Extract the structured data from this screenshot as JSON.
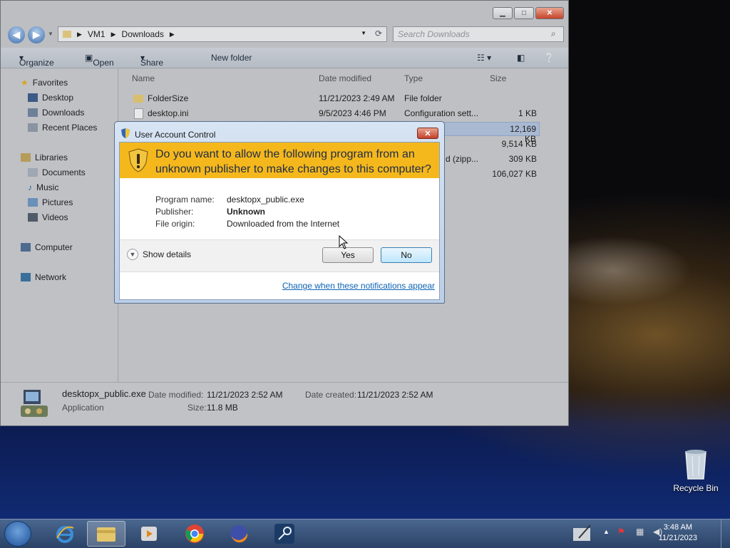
{
  "explorer": {
    "breadcrumb": [
      "VM1",
      "Downloads"
    ],
    "search_placeholder": "Search Downloads",
    "toolbar": {
      "organize": "Organize",
      "open": "Open",
      "share_with": "Share with",
      "new_folder": "New folder"
    },
    "nav": {
      "favorites": "Favorites",
      "desktop": "Desktop",
      "downloads": "Downloads",
      "recent": "Recent Places",
      "libraries": "Libraries",
      "documents": "Documents",
      "music": "Music",
      "pictures": "Pictures",
      "videos": "Videos",
      "computer": "Computer",
      "network": "Network"
    },
    "columns": {
      "name": "Name",
      "date": "Date modified",
      "type": "Type",
      "size": "Size"
    },
    "files": [
      {
        "name": "FolderSize",
        "date": "11/21/2023 2:49 AM",
        "type": "File folder",
        "size": ""
      },
      {
        "name": "desktop.ini",
        "date": "9/5/2023 4:46 PM",
        "type": "Configuration sett...",
        "size": "1 KB"
      },
      {
        "name": "",
        "date": "",
        "type": "",
        "size": "12,169 KB"
      },
      {
        "name": "",
        "date": "",
        "type": "",
        "size": "9,514 KB"
      },
      {
        "name": "",
        "date": "",
        "type": "d (zipp...",
        "size": "309 KB"
      },
      {
        "name": "",
        "date": "",
        "type": "",
        "size": "106,027 KB"
      }
    ],
    "details": {
      "filename": "desktopx_public.exe",
      "kind": "Application",
      "modified_label": "Date modified:",
      "modified": "11/21/2023 2:52 AM",
      "created_label": "Date created:",
      "created": "11/21/2023 2:52 AM",
      "size_label": "Size:",
      "size": "11.8 MB"
    }
  },
  "uac": {
    "title": "User Account Control",
    "question": "Do you want to allow the following program from an unknown publisher to make changes to this computer?",
    "program_label": "Program name:",
    "program": "desktopx_public.exe",
    "publisher_label": "Publisher:",
    "publisher": "Unknown",
    "origin_label": "File origin:",
    "origin": "Downloaded from the Internet",
    "show_details": "Show details",
    "yes": "Yes",
    "no": "No",
    "link": "Change when these notifications appear"
  },
  "desktop": {
    "recycle_bin": "Recycle Bin"
  },
  "taskbar": {
    "time": "3:48 AM",
    "date": "11/21/2023"
  }
}
